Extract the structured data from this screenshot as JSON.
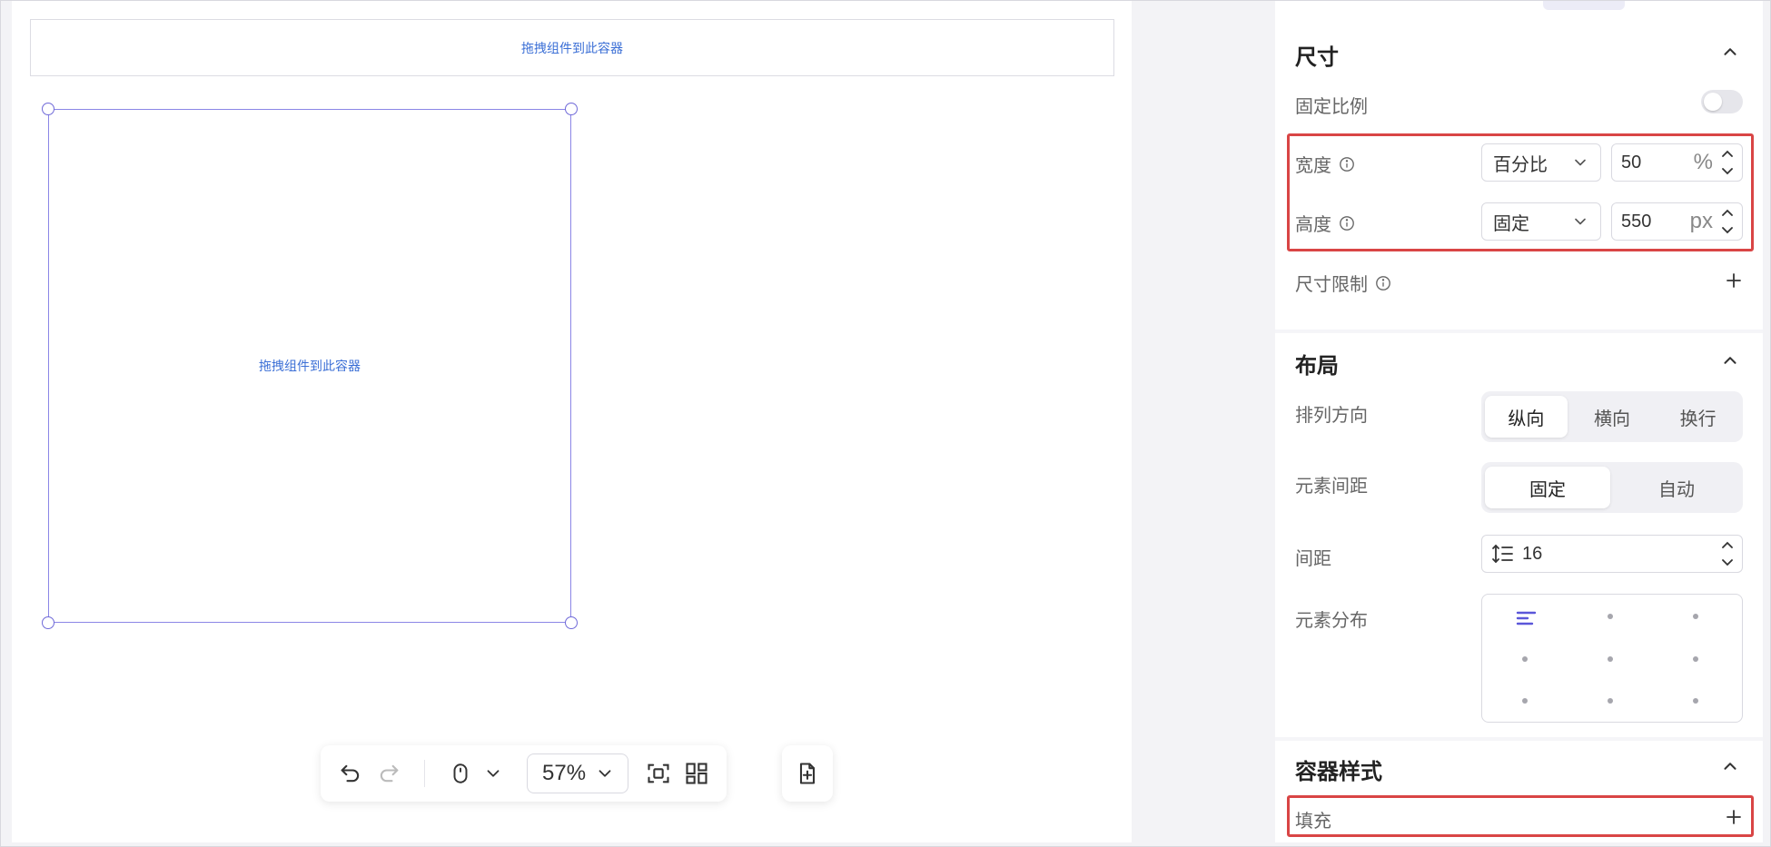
{
  "canvas": {
    "dropzone_top_text": "拖拽组件到此容器",
    "dropzone_box_text": "拖拽组件到此容器"
  },
  "toolbar": {
    "zoom_value": "57%",
    "icons": [
      "undo-icon",
      "redo-icon",
      "mouse-icon",
      "chevron-down-icon",
      "fit-screen-icon",
      "grid-icon",
      "add-page-icon"
    ]
  },
  "panel": {
    "size_section": {
      "title": "尺寸",
      "fixed_ratio_label": "固定比例",
      "fixed_ratio_on": false,
      "width_label": "宽度",
      "width_mode": "百分比",
      "width_value": "50",
      "width_unit": "%",
      "height_label": "高度",
      "height_mode": "固定",
      "height_value": "550",
      "height_unit": "px",
      "limit_label": "尺寸限制"
    },
    "layout_section": {
      "title": "布局",
      "direction_label": "排列方向",
      "direction_options": [
        "纵向",
        "横向",
        "换行"
      ],
      "direction_selected": "纵向",
      "spacing_mode_label": "元素间距",
      "spacing_mode_options": [
        "固定",
        "自动"
      ],
      "spacing_mode_selected": "固定",
      "gap_label": "间距",
      "gap_value": "16",
      "distribution_label": "元素分布"
    },
    "container_style_section": {
      "title": "容器样式",
      "fill_label": "填充"
    }
  },
  "colors": {
    "accent": "#5b57d9",
    "highlight": "#d94545",
    "link_text": "#3b6fd6"
  }
}
